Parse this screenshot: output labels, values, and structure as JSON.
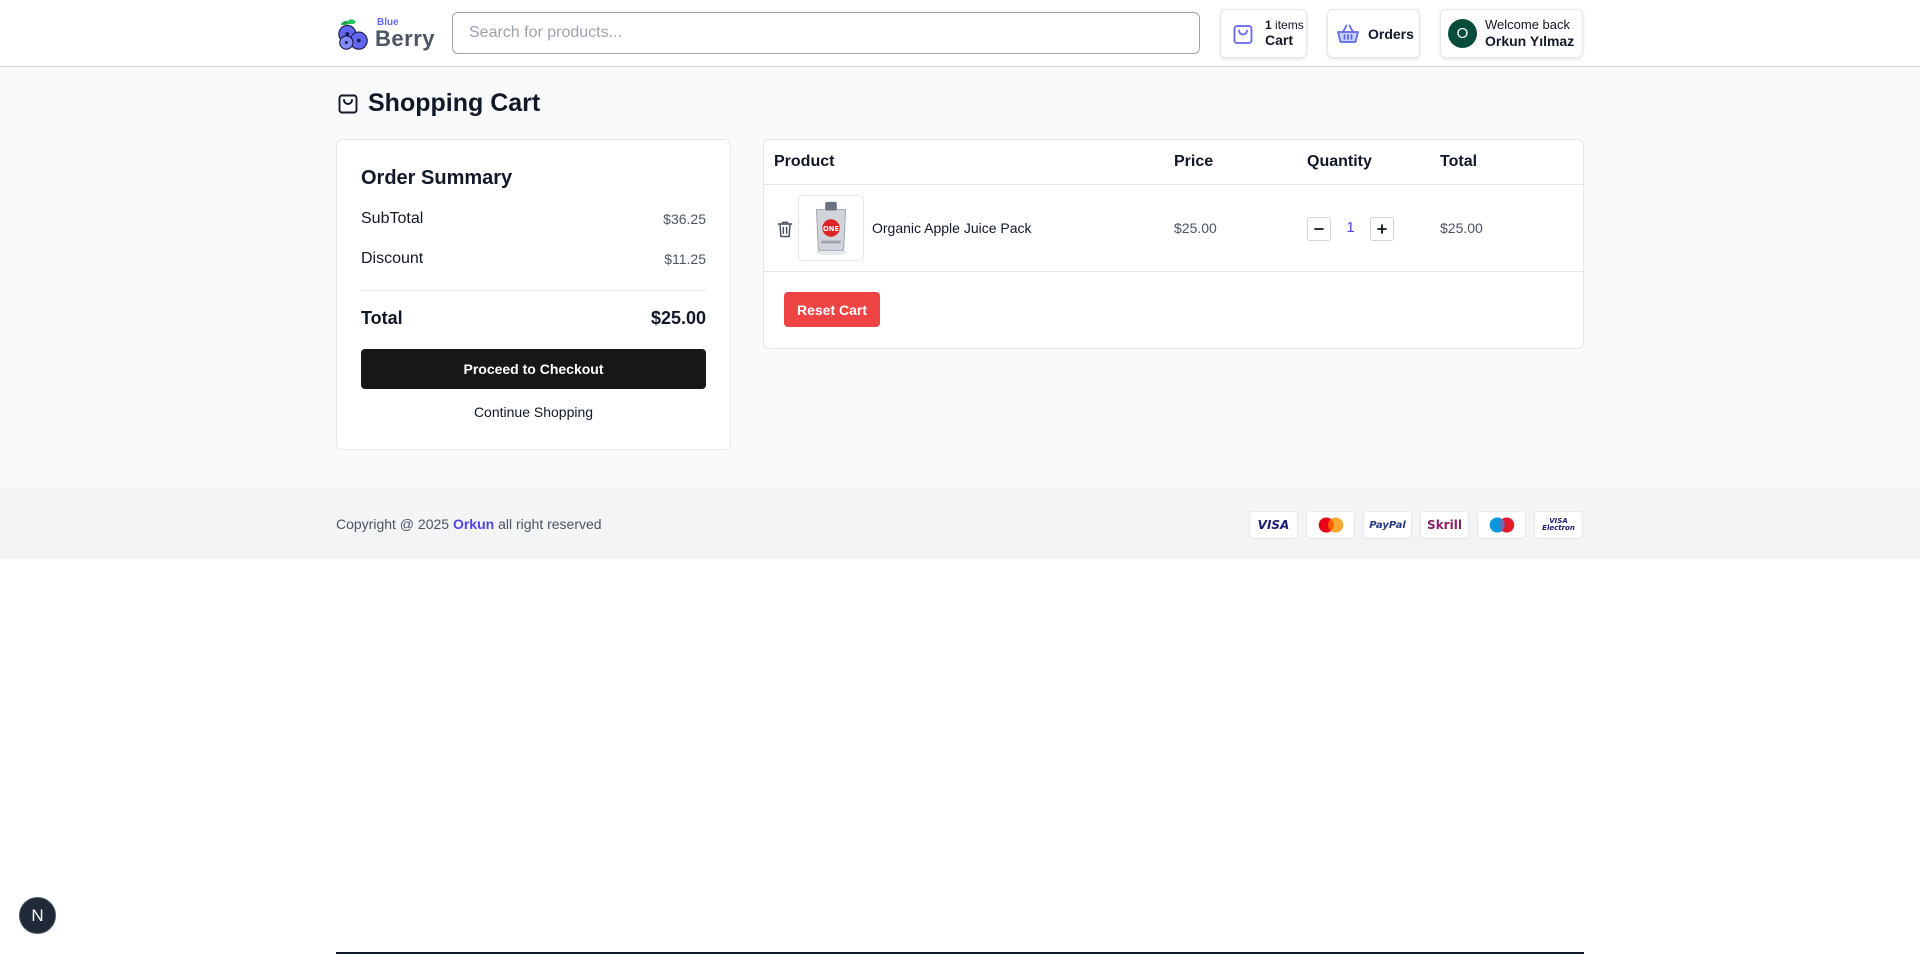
{
  "brand": {
    "small": "Blue",
    "big": "Berry"
  },
  "search": {
    "placeholder": "Search for products..."
  },
  "header": {
    "cart": {
      "count": "1",
      "count_suffix": " items",
      "label": "Cart"
    },
    "orders": {
      "label": "Orders"
    },
    "user": {
      "initial": "O",
      "welcome": "Welcome back",
      "name": "Orkun Yılmaz"
    }
  },
  "page": {
    "title": "Shopping Cart"
  },
  "summary": {
    "title": "Order Summary",
    "subtotal_label": "SubTotal",
    "subtotal_value": "$36.25",
    "discount_label": "Discount",
    "discount_value": "$11.25",
    "total_label": "Total",
    "total_value": "$25.00",
    "checkout_label": "Proceed to Checkout",
    "continue_label": "Continue Shopping"
  },
  "cart_table": {
    "headers": [
      "Product",
      "Price",
      "Quantity",
      "Total"
    ],
    "rows": [
      {
        "product": "Organic Apple Juice Pack",
        "price": "$25.00",
        "quantity": "1",
        "total": "$25.00",
        "thumb_text": "ONE"
      }
    ],
    "reset_label": "Reset Cart"
  },
  "footer": {
    "copyright_prefix": "Copyright @ 2025 ",
    "copyright_link": "Orkun",
    "copyright_suffix": " all right reserved",
    "payments": [
      "VISA",
      "mastercard",
      "PayPal",
      "Skrill",
      "Maestro",
      "VISA Electron"
    ],
    "payment_texts": {
      "visa": "VISA",
      "paypal": "PayPal",
      "skrill": "Skrill",
      "electron_top": "VISA",
      "electron_bottom": "Electron"
    }
  },
  "devtools": {
    "badge": "N"
  },
  "colors": {
    "accent": "#4f46e5",
    "danger": "#ef4444",
    "dark": "#171717",
    "avatar": "#064e3b"
  }
}
